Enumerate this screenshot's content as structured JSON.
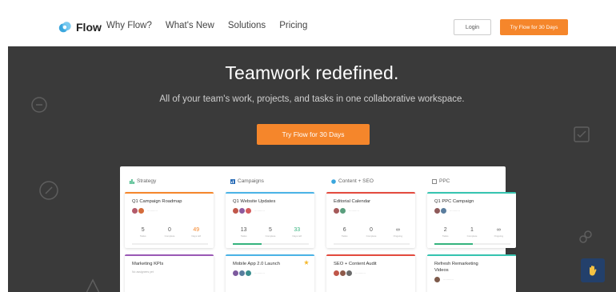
{
  "nav": {
    "logo_text": "Flow",
    "links": [
      "Why Flow?",
      "What's New",
      "Solutions",
      "Pricing"
    ],
    "login_label": "Login",
    "try_label": "Try Flow for 30 Days"
  },
  "hero": {
    "title": "Teamwork redefined.",
    "subtitle": "All of your team's work, projects, and tasks in one collaborative workspace.",
    "cta_label": "Try Flow for 30 Days"
  },
  "board": {
    "columns": [
      {
        "name": "Strategy",
        "icon": "bar-chart-icon",
        "accent": "#f5862b",
        "cards": [
          {
            "title": "Q1 Campaign Roadmap",
            "stats": [
              {
                "n": "5",
                "l": "Tasks"
              },
              {
                "n": "0",
                "l": "Complete"
              },
              {
                "n": "49",
                "l": "Days left"
              }
            ]
          },
          {
            "title": "Marketing KPIs",
            "sub": "No assignees yet"
          }
        ]
      },
      {
        "name": "Campaigns",
        "icon": "chart-icon",
        "accent": "#4ab3e6",
        "cards": [
          {
            "title": "Q1 Website Updates",
            "stats": [
              {
                "n": "13",
                "l": "Tasks"
              },
              {
                "n": "5",
                "l": "Complete"
              },
              {
                "n": "33",
                "l": "Days left"
              }
            ]
          },
          {
            "title": "Mobile App 2.0 Launch"
          }
        ]
      },
      {
        "name": "Content + SEO",
        "icon": "globe-icon",
        "accent": "#e34a3e",
        "cards": [
          {
            "title": "Editorial Calendar",
            "stats": [
              {
                "n": "6",
                "l": "Tasks"
              },
              {
                "n": "0",
                "l": "Complete"
              },
              {
                "n": "∞",
                "l": "Ongoing"
              }
            ]
          },
          {
            "title": "SEO + Content Audit"
          }
        ]
      },
      {
        "name": "PPC",
        "icon": "ppc-icon",
        "accent": "#35c4b0",
        "cards": [
          {
            "title": "Q1 PPC Campaign",
            "stats": [
              {
                "n": "2",
                "l": "Tasks"
              },
              {
                "n": "1",
                "l": "Complete"
              },
              {
                "n": "∞",
                "l": "Ongoing"
              }
            ]
          },
          {
            "title": "Refresh Remarketing Videos"
          }
        ]
      }
    ]
  },
  "colors": {
    "brand_orange": "#f5862b",
    "hero_bg": "#3a3a3a",
    "chat_button": "#23406b"
  }
}
